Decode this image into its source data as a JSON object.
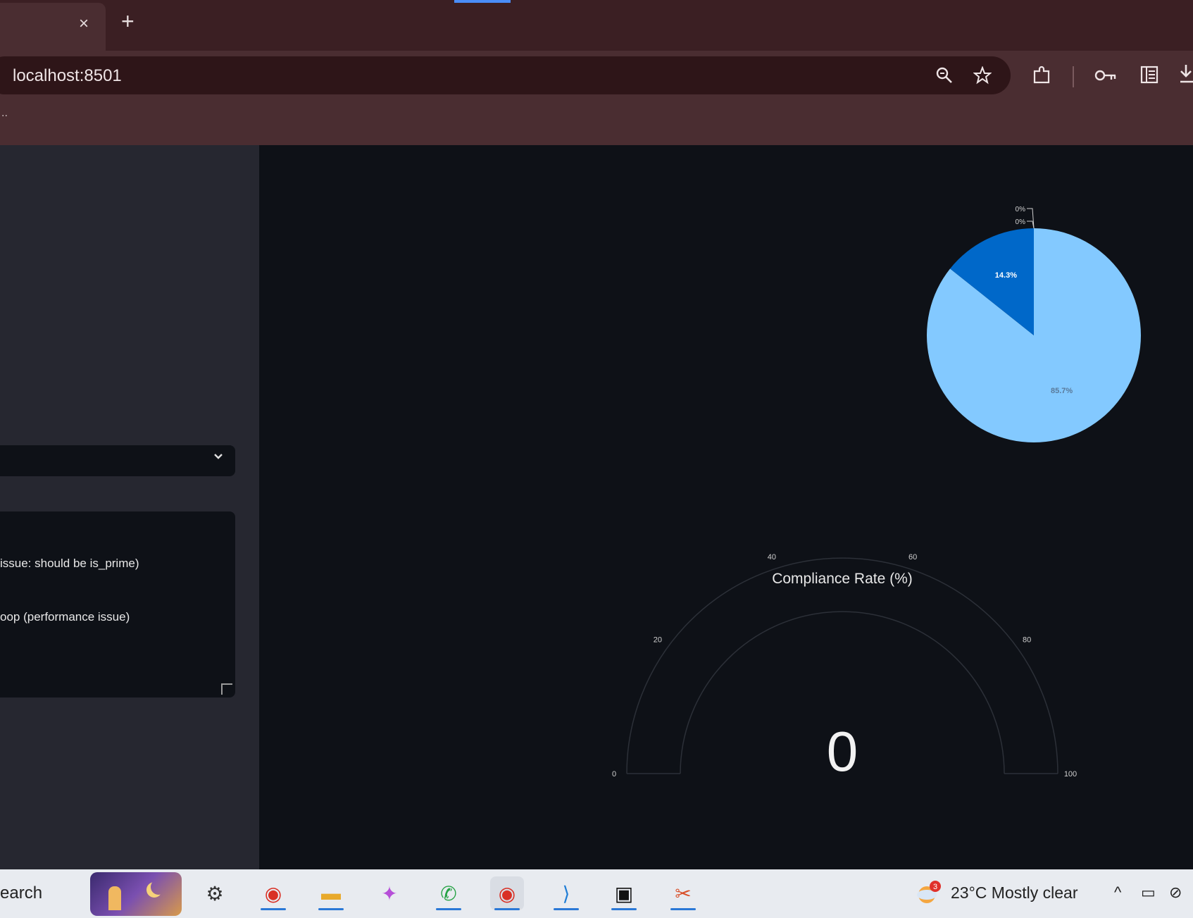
{
  "browser": {
    "tab_close": "×",
    "new_tab": "+",
    "url": "localhost:8501",
    "bookmarks_overflow": "..",
    "icons": {
      "zoom": "zoom-icon",
      "star": "bookmark-star-icon",
      "extensions": "extensions-icon",
      "passwords": "password-key-icon",
      "reading": "reading-list-icon",
      "download": "download-icon"
    }
  },
  "sidebar": {
    "text_area_lines": [
      "issue: should be is_prime)",
      "oop (performance issue)"
    ]
  },
  "charts": {
    "colors": {
      "light": "#83c9ff",
      "dark": "#0068c9",
      "bg": "#0e1117"
    }
  },
  "chart_data": [
    {
      "type": "pie",
      "labels": [
        "",
        "",
        "",
        ""
      ],
      "values": [
        85.7,
        14.3,
        0,
        0
      ],
      "slice_labels": [
        "85.7%",
        "14.3%",
        "0%",
        "0%"
      ],
      "colors": [
        "#83c9ff",
        "#0068c9",
        "#ffabab",
        "#ff2b2b"
      ]
    },
    {
      "type": "gauge",
      "title": "Compliance Rate (%)",
      "value": 0,
      "range": [
        0,
        100
      ],
      "ticks": [
        "0",
        "20",
        "40",
        "60",
        "80",
        "100"
      ]
    }
  ],
  "taskbar": {
    "search_text": "earch",
    "weather": "23°C  Mostly clear",
    "weather_badge": "3",
    "apps": [
      {
        "name": "settings-app-icon",
        "glyph": "⚙"
      },
      {
        "name": "chrome-app-icon",
        "glyph": "◉"
      },
      {
        "name": "file-explorer-app-icon",
        "glyph": "▬"
      },
      {
        "name": "copilot-app-icon",
        "glyph": "✦"
      },
      {
        "name": "whatsapp-app-icon",
        "glyph": "✆"
      },
      {
        "name": "chrome-profile-app-icon",
        "glyph": "◉"
      },
      {
        "name": "vscode-app-icon",
        "glyph": "⟩"
      },
      {
        "name": "terminal-app-icon",
        "glyph": "▣"
      },
      {
        "name": "snipping-tool-app-icon",
        "glyph": "✂"
      }
    ],
    "tray": {
      "chevron": "^",
      "battery": "▭",
      "network": "⊘"
    }
  }
}
